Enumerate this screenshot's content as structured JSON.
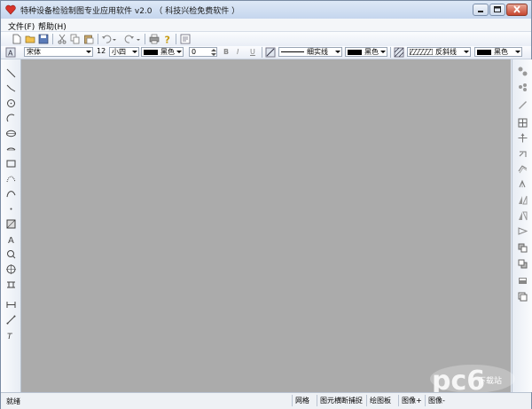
{
  "window": {
    "title": "特种设备检验制图专业应用软件 v2.0 （ 科技兴检免费软件 ）",
    "icons": {
      "app": "heart-app-icon",
      "min": "minimize-icon",
      "max": "maximize-icon",
      "close": "close-icon"
    }
  },
  "menu": {
    "items": [
      {
        "label": "文件(F)"
      },
      {
        "label": "帮助(H)"
      }
    ]
  },
  "toolbar1": {
    "icons": [
      "new-file-icon",
      "open-folder-icon",
      "save-icon",
      "cut-icon",
      "copy-icon",
      "paste-icon",
      "undo-icon",
      "redo-icon",
      "print-icon",
      "help-icon",
      "properties-icon"
    ]
  },
  "toolbar2": {
    "font_name": "宋体",
    "font_size": "12",
    "font_size_name": "小四",
    "text_color": "黑色",
    "spin_value": "0",
    "bold": "B",
    "italic": "I",
    "underline": "U",
    "line_type": "细实线",
    "line_color": "黑色",
    "hatch": "反斜线",
    "hatch_color": "黑色"
  },
  "left_tools": [
    "line-icon",
    "polyline-icon",
    "circle-icon",
    "arc-icon",
    "ellipse-icon",
    "ellipse-arc-icon",
    "rectangle-icon",
    "bezier-icon",
    "curve-icon",
    "point-icon",
    "hatch-icon",
    "text-icon",
    "magnifier-icon",
    "crosshair-icon",
    "stamp-icon",
    "dimension-icon",
    "align-icon",
    "insert-text-icon"
  ],
  "right_tools": [
    "select-icon",
    "multi-select-icon",
    "pen-icon",
    "grid-icon",
    "move-icon",
    "rotate-icon",
    "copy-rotate-icon",
    "mirror-icon",
    "flip-horizontal-icon",
    "flip-vertical-icon",
    "arrow-icon",
    "layer-front-icon",
    "layer-back-icon",
    "group-icon",
    "ungroup-icon"
  ],
  "status": {
    "ready": "就绪",
    "cells": [
      "网格",
      "图元横断捕捉",
      "绘图板",
      "图像+",
      "图像-"
    ]
  },
  "watermark": {
    "text": "下载站"
  },
  "colors": {
    "canvas": "#ababab",
    "title_bg": "#c5d6ee"
  }
}
